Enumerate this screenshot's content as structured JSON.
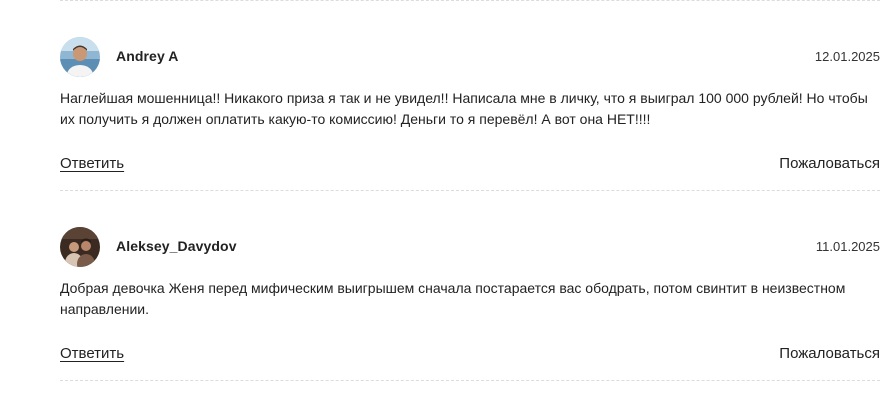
{
  "comments": [
    {
      "author": "Andrey A",
      "date": "12.01.2025",
      "text": "Наглейшая мошенница!! Никакого приза я так и не увидел!! Написала мне в личку, что я выиграл 100 000 рублей! Но чтобы их получить я должен оплатить какую-то комиссию! Деньги то я перевёл! А вот она НЕТ!!!!",
      "reply_label": "Ответить",
      "complain_label": "Пожаловаться"
    },
    {
      "author": "Aleksey_Davydov",
      "date": "11.01.2025",
      "text": "Добрая девочка Женя перед мифическим выигрышем сначала постарается вас ободрать, потом свинтит в неизвестном направлении.",
      "reply_label": "Ответить",
      "complain_label": "Пожаловаться"
    }
  ]
}
